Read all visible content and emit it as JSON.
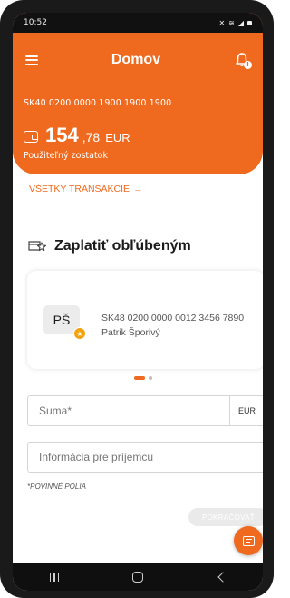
{
  "status_bar": {
    "time": "10:52",
    "icons": [
      "silent-icon",
      "wifi-icon",
      "signal-icon",
      "battery-icon"
    ]
  },
  "header": {
    "title": "Domov",
    "menu_icon": "hamburger-menu-icon",
    "notification_icon": "bell-icon"
  },
  "account": {
    "iban": "SK40 0200 0000 1900 1900 1900",
    "balance_integer": "154",
    "balance_decimal": ",78",
    "currency": "EUR",
    "balance_label": "Použiteľný zostatok",
    "wallet_icon": "wallet-icon"
  },
  "transactions_link": {
    "label": "VŠETKY TRANSAKCIE",
    "arrow": "→"
  },
  "favorites": {
    "heading": "Zaplatiť obľúbeným",
    "heading_icon": "favorite-payment-icon",
    "items": [
      {
        "initials": "PŠ",
        "iban": "SK48 0200 0000 0012 3456 7890",
        "name": "Patrik Šporivý",
        "badge_icon": "star-icon"
      }
    ],
    "pager": {
      "current": 1,
      "total": 2
    }
  },
  "form": {
    "amount_placeholder": "Suma*",
    "amount_currency": "EUR",
    "info_placeholder": "Informácia pre príjemcu",
    "required_note": "*POVINNÉ POLIA",
    "continue_label": "POKRAČOVAŤ"
  },
  "fab": {
    "icon": "receipt-icon"
  },
  "nav_bar": {
    "icons": [
      "recent-apps-icon",
      "home-icon",
      "back-icon"
    ]
  },
  "colors": {
    "accent": "#ef6a1e",
    "badge": "#f2a20d"
  }
}
